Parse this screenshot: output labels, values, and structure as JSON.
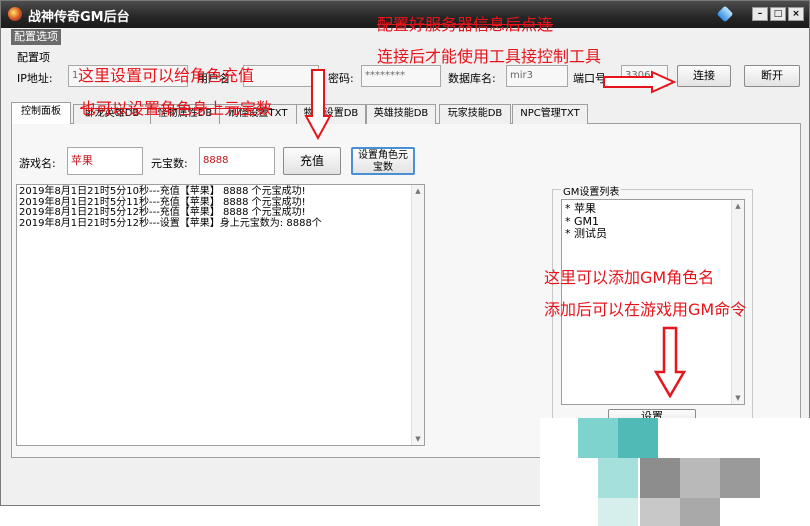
{
  "window": {
    "title": "战神传奇GM后台",
    "controls": {
      "minimize": "–",
      "maximize": "□",
      "close": "×"
    }
  },
  "menu": {
    "config_options": "配置选项"
  },
  "config": {
    "group_label": "配置项",
    "ip_label": "IP地址:",
    "ip_value": "1",
    "user_label": "用户名:",
    "user_value": "",
    "password_label": "密码:",
    "password_value": "********",
    "db_label": "数据库名:",
    "db_value": "mir3",
    "port_label": "端口号:",
    "port_value": "3306",
    "connect_label": "连接",
    "disconnect_label": "断开"
  },
  "tabs": [
    {
      "label": "控制面板",
      "active": true
    },
    {
      "label": "卧龙英雄DB"
    },
    {
      "label": "怪物属性DB"
    },
    {
      "label": "刷怪设置TXT"
    },
    {
      "label": "物品设置DB"
    },
    {
      "label": "英雄技能DB"
    },
    {
      "label": "玩家技能DB"
    },
    {
      "label": "NPC管理TXT"
    }
  ],
  "control_panel": {
    "player_label": "游戏名:",
    "player_value": "苹果",
    "yuanbao_label": "元宝数:",
    "yuanbao_value": "8888",
    "recharge_label": "充值",
    "set_yuanbao_label": "设置角色元宝数",
    "log": [
      "2019年8月1日21时5分10秒---充值【苹果】 8888 个元宝成功!",
      "2019年8月1日21时5分11秒---充值【苹果】 8888 个元宝成功!",
      "2019年8月1日21时5分12秒---充值【苹果】 8888 个元宝成功!",
      "2019年8月1日21时5分12秒---设置【苹果】身上元宝数为: 8888个"
    ]
  },
  "gm": {
    "group_title": "GM设置列表",
    "list": [
      "* 苹果",
      "* GM1",
      "* 测试员"
    ],
    "set_label": "设置"
  },
  "annotations": {
    "top_right_1": "配置好服务器信息后点连",
    "top_right_2": "连接后才能使用工具接控制工具",
    "left_1": "这里设置可以给角色充值",
    "left_2": "也可以设置角色身上元宝数",
    "right_1": "这里可以添加GM角色名",
    "right_2": "添加后可以在游戏用GM命令"
  },
  "colors": {
    "annotation": "#e8141c",
    "titlebar": "#262626",
    "input_text": "#c0141c"
  }
}
